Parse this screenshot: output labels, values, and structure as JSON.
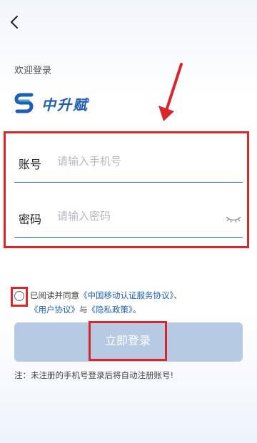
{
  "header": {
    "back_icon": "chevron-left-icon"
  },
  "welcome_text": "欢迎登录",
  "brand": {
    "name": "中升赋",
    "color": "#1f5fb3"
  },
  "annotation": {
    "color": "#d9262c"
  },
  "form": {
    "account": {
      "label": "账号",
      "placeholder": "请输入手机号",
      "value": ""
    },
    "password": {
      "label": "密码",
      "placeholder": "请输入密码",
      "value": "",
      "eye_icon": "eye-closed-icon"
    }
  },
  "agreement": {
    "checked": false,
    "prefix": "已阅读并同意",
    "link1": "《中国移动认证服务协议》",
    "sep1": "、",
    "link2": "《用户协议》",
    "sep2": "与",
    "link3": "《隐私政策》",
    "suffix": "。"
  },
  "login_button": {
    "label": "立即登录",
    "color": "#b7cae4"
  },
  "note": "注：未注册的手机号登录后将自动注册账号!"
}
